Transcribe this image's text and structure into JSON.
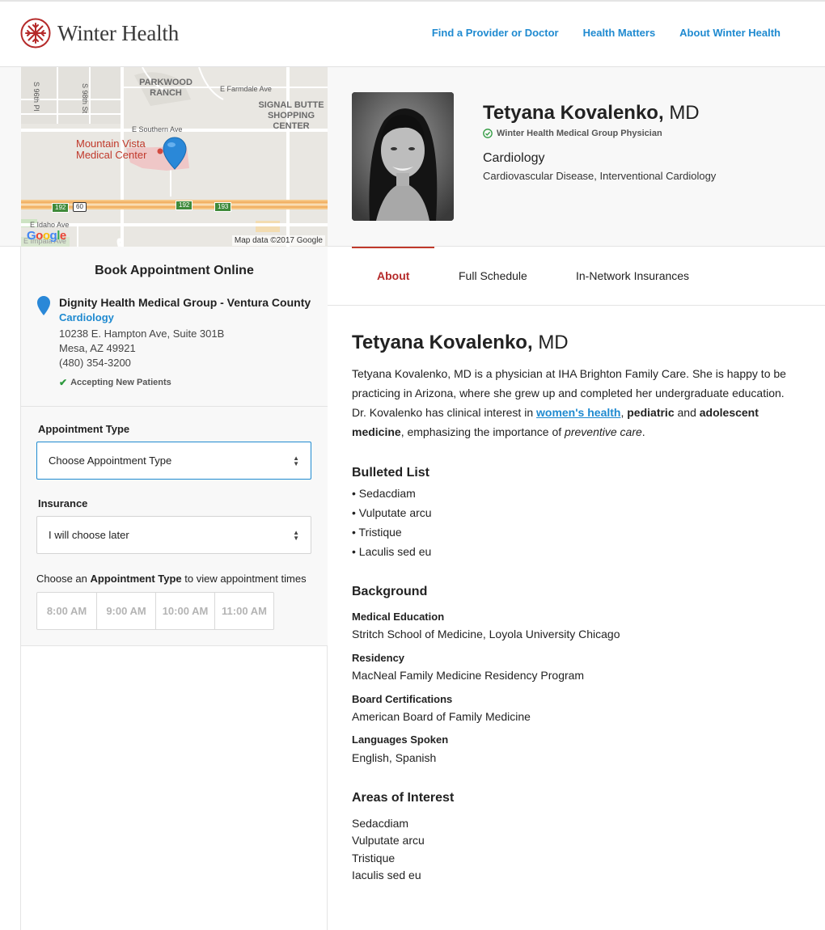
{
  "header": {
    "logo_text": "Winter Health",
    "nav": [
      "Find a Provider or Doctor",
      "Health Matters",
      "About Winter Health"
    ]
  },
  "map": {
    "labels": {
      "parkwood": "PARKWOOD RANCH",
      "signal": "SIGNAL BUTTE SHOPPING CENTER",
      "s96": "S 96th Pl",
      "s98": "S 98th St",
      "farmdale": "E Farmdale Ave",
      "southern": "E Southern Ave",
      "mountain_vista": "Mountain Vista Medical Center",
      "idaho": "E Idaho Ave",
      "impala": "E Impala Ave",
      "r192a": "192",
      "r60": "60",
      "r192b": "192",
      "r193": "193"
    },
    "google": "Google",
    "attribution": "Map data ©2017 Google"
  },
  "profile": {
    "name": "Tetyana Kovalenko,",
    "credential": "MD",
    "medical_group": "Winter Health Medical Group Physician",
    "specialty": "Cardiology",
    "subspecialties": "Cardiovascular Disease, Interventional Cardiology"
  },
  "booking": {
    "title": "Book Appointment Online",
    "location_name": "Dignity Health Medical Group - Ventura County",
    "location_specialty": "Cardiology",
    "address_line1": "10238 E. Hampton Ave, Suite 301B",
    "address_line2": "Mesa, AZ 49921",
    "phone": "(480) 354-3200",
    "accepting": "Accepting New Patients",
    "appointment_type_label": "Appointment Type",
    "appointment_type_value": "Choose Appointment Type",
    "insurance_label": "Insurance",
    "insurance_value": "I will choose later",
    "choose_prefix": "Choose an",
    "choose_bold": "Appointment Type",
    "choose_suffix": "to view appointment times",
    "times": [
      "8:00 AM",
      "9:00 AM",
      "10:00 AM",
      "11:00 AM"
    ]
  },
  "tabs": [
    "About",
    "Full Schedule",
    "In-Network Insurances"
  ],
  "about": {
    "name": "Tetyana Kovalenko,",
    "credential": "MD",
    "bio_1": "Tetyana Kovalenko, MD is a physician at IHA Brighton Family Care. She is happy to be practicing in Arizona, where she grew up and completed her undergraduate education. Dr. Kovalenko has clinical interest in ",
    "bio_link": "women's health",
    "bio_2": ", ",
    "bio_bold1": "pediatric",
    "bio_3": " and ",
    "bio_bold2": "adolescent medicine",
    "bio_4": ", emphasizing the importance of ",
    "bio_italic": "preventive care",
    "bio_5": ".",
    "bulleted_title": "Bulleted List",
    "bullets": [
      "• Sedacdiam",
      "• Vulputate arcu",
      "• Tristique",
      "• Laculis sed eu"
    ],
    "background_title": "Background",
    "background": [
      {
        "label": "Medical Education",
        "value": "Stritch School of Medicine, Loyola University Chicago"
      },
      {
        "label": "Residency",
        "value": "MacNeal Family Medicine Residency Program"
      },
      {
        "label": "Board Certifications",
        "value": "American Board of Family Medicine"
      },
      {
        "label": "Languages Spoken",
        "value": "English, Spanish"
      }
    ],
    "interests_title": "Areas of Interest",
    "interests": [
      "Sedacdiam",
      "Vulputate arcu",
      "Tristique",
      "Iaculis sed eu"
    ]
  },
  "colors": {
    "brand_red": "#b52a2a",
    "link_blue": "#1f8ad0",
    "check_green": "#2e9a3f"
  }
}
